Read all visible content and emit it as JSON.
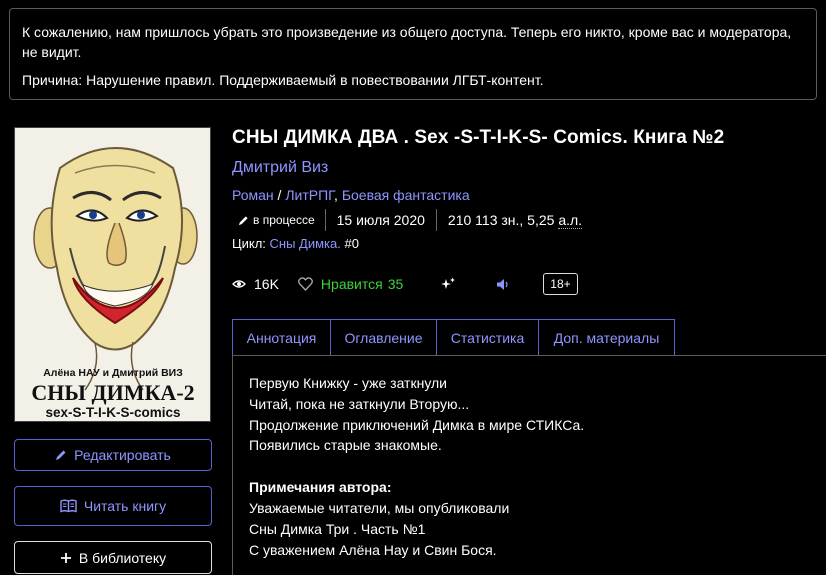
{
  "notice": {
    "message": "К сожалению, нам пришлось убрать это произведение из общего доступа. Теперь его никто, кроме вас и модератора, не видит.",
    "reason": "Причина: Нарушение правил. Поддерживаемый в повествовании ЛГБТ-контент."
  },
  "cover": {
    "authors": "Алёна НАУ и Дмитрий ВИЗ",
    "title": "СНЫ ДИМКА-2",
    "subtitle": "sex-S-T-I-K-S-comics"
  },
  "book": {
    "title": "СНЫ ДИМКА ДВА . Sex -S-T-I-K-S- Comics. Книга №2",
    "author": "Дмитрий Виз",
    "genres": [
      "Роман",
      "ЛитРПГ",
      "Боевая фантастика"
    ],
    "genre_sep1": " / ",
    "genre_sep2": ", ",
    "status": "в процессе",
    "date": "15 июля 2020",
    "size_chars": "210 113 зн., 5,25 ",
    "size_al": "а.л.",
    "cycle_label": "Цикл: ",
    "cycle_name": "Сны Димка.",
    "cycle_num": " #0"
  },
  "stats": {
    "views": "16K",
    "likes_label": "Нравится",
    "likes": "35",
    "age": "18+"
  },
  "tabs": [
    "Аннотация",
    "Оглавление",
    "Статистика",
    "Доп. материалы"
  ],
  "annotation": {
    "lines": [
      "Первую Книжку - уже заткнули",
      "Читай, пока не заткнули Вторую...",
      "Продолжение приключений Димка в мире СТИКСа.",
      "Появились старые знакомые."
    ],
    "notes_heading": "Примечания автора:",
    "notes": [
      "Уважаемые читатели, мы опубликовали",
      "Сны Димка Три . Часть №1",
      "С уважением Алёна Нау и Свин Бося."
    ]
  },
  "actions": {
    "edit": "Редактировать",
    "read": "Читать книгу",
    "library": "В библиотеку"
  },
  "colors": {
    "accent": "#8f95ff",
    "like_green": "#3bd23b",
    "background": "#000000"
  },
  "icons": [
    "pencil-icon",
    "book-open-icon",
    "plus-icon",
    "eye-icon",
    "heart-icon",
    "sparkle-icon",
    "speaker-icon"
  ]
}
